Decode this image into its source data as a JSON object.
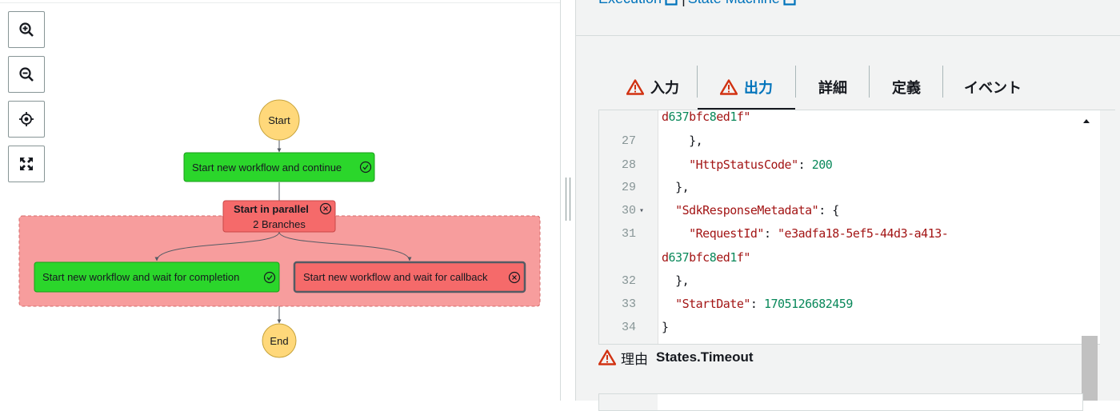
{
  "graph": {
    "zoom_controls": [
      {
        "name": "zoom-in-button",
        "icon": "zoom-in-icon"
      },
      {
        "name": "zoom-out-button",
        "icon": "zoom-out-icon"
      },
      {
        "name": "center-button",
        "icon": "crosshair-icon"
      },
      {
        "name": "fit-view-button",
        "icon": "expand-icon"
      }
    ],
    "nodes": {
      "start": "Start",
      "continue": "Start new workflow and continue",
      "parallel_title": "Start in parallel",
      "parallel_sub": "2 Branches",
      "wait_completion": "Start new workflow and wait for completion",
      "wait_callback": "Start new workflow and wait for callback",
      "end": "End"
    },
    "colors": {
      "success": "#2bd62b",
      "failed": "#f56a6a",
      "parallel_area": "#f79d9d",
      "terminal": "#ffd87a"
    }
  },
  "header": {
    "execution_link": "Execution",
    "separator": "|",
    "state_machine_link": "State Machine"
  },
  "tabs": [
    {
      "label": "入力",
      "warning": true
    },
    {
      "label": "出力",
      "warning": true,
      "active": true
    },
    {
      "label": "詳細"
    },
    {
      "label": "定義"
    },
    {
      "label": "イベント"
    }
  ],
  "code": {
    "lines": [
      {
        "n": "",
        "text": "d637bfc8ed1f\""
      },
      {
        "n": "27",
        "text": "    },"
      },
      {
        "n": "28",
        "text": "    \"HttpStatusCode\": 200"
      },
      {
        "n": "29",
        "text": "  },"
      },
      {
        "n": "30",
        "text": "  \"SdkResponseMetadata\": {",
        "fold": "▾"
      },
      {
        "n": "31",
        "text": "    \"RequestId\": \"e3adfa18-5ef5-44d3-a413-"
      },
      {
        "n": "",
        "text": "d637bfc8ed1f\""
      },
      {
        "n": "32",
        "text": "  },"
      },
      {
        "n": "33",
        "text": "  \"StartDate\": 1705126682459"
      },
      {
        "n": "34",
        "text": "}"
      }
    ]
  },
  "reason": {
    "label": "理由",
    "value": "States.Timeout"
  }
}
